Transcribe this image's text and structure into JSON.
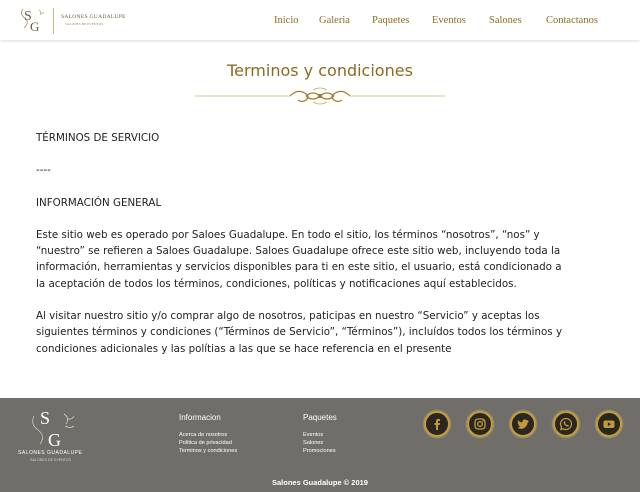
{
  "brand": {
    "monogram": "SG",
    "name": "SALONES GUADALUPE",
    "subtitle": "SALONES DE EVENTOS"
  },
  "nav": {
    "items": [
      "Inicio",
      "Galeria",
      "Paquetes",
      "Eventos",
      "Salones",
      "Contactanos"
    ]
  },
  "page": {
    "title": "Terminos y condiciones"
  },
  "content": {
    "heading": "TÉRMINOS DE SERVICIO",
    "separator": "----",
    "section_title": "INFORMACIÓN GENERAL",
    "paragraph1": "Este sitio web es operado por Saloes Guadalupe. En todo el sitio, los términos “nosotros”, “nos” y “nuestro” se refieren a Saloes Guadalupe. Saloes Guadalupe ofrece este sitio web, incluyendo toda la información, herramientas y servicios disponibles para ti en este sitio, el usuario, está condicionado a la aceptación de todos los términos, condiciones, políticas y notificaciones aquí establecidos.",
    "paragraph2": "Al visitar nuestro sitio y/o comprar algo de nosotros, paticipas en nuestro “Servicio” y aceptas los siguientes términos y condiciones (“Términos de Servicio”, “Términos”), incluídos todos los términos y condiciones adicionales y las polítias a las que se hace referencia en el presente"
  },
  "footer": {
    "logo_name": "SALONES GUADALUPE",
    "logo_sub": "SALONES DE EVENTOS",
    "info_title": "Informacion",
    "info_links": [
      "Acerca de nosotros",
      "Politica de privacidad",
      "Terminos y condiciones"
    ],
    "packages_title": "Paquetes",
    "packages_links": [
      "Eventos",
      "Salones",
      "Promociones"
    ],
    "copyright": "Salones Guadalupe © 2019",
    "social": [
      "facebook-icon",
      "instagram-icon",
      "twitter-icon",
      "whatsapp-icon",
      "youtube-icon"
    ],
    "accent_color": "#c39a3a",
    "bg_color": "#6f6e69"
  }
}
